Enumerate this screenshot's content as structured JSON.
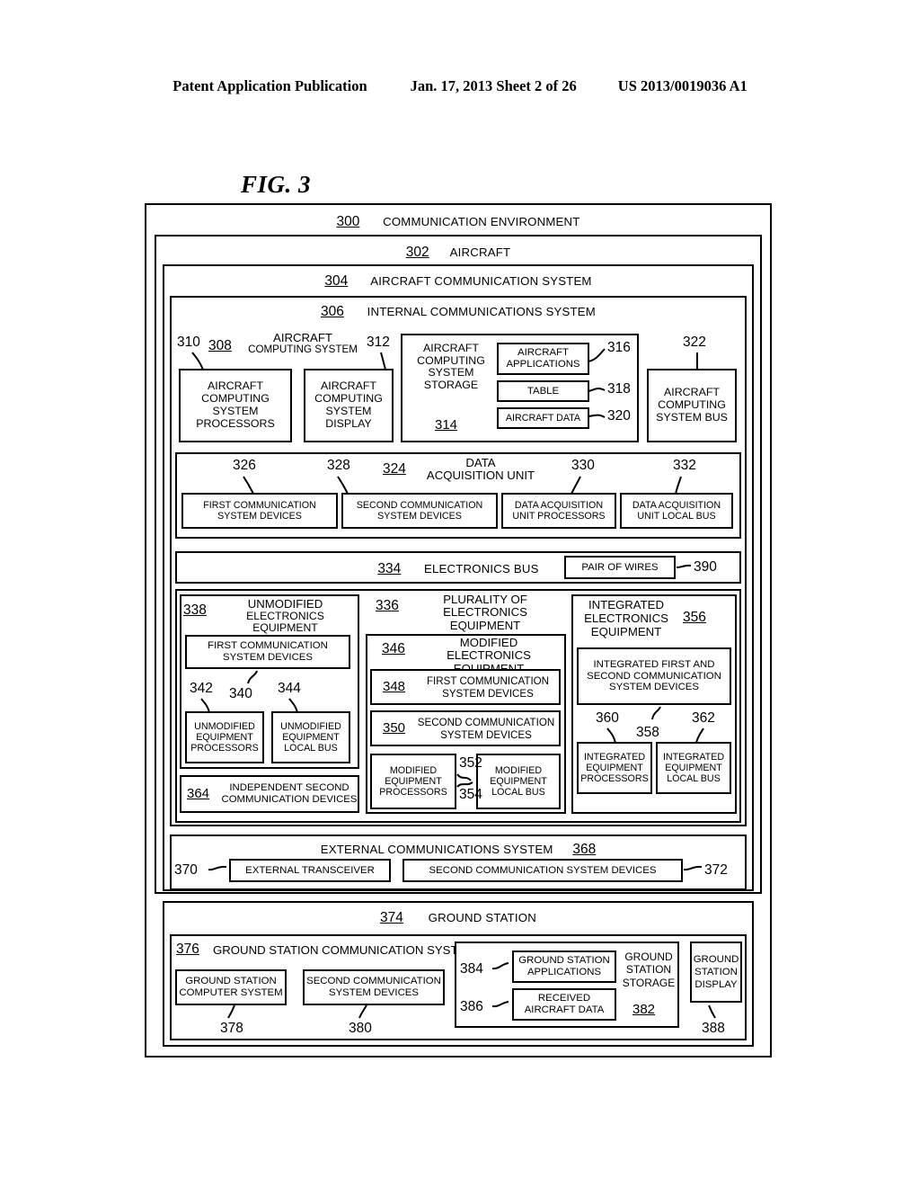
{
  "header": {
    "title": "Patent Application Publication",
    "date_sheet": "Jan. 17, 2013  Sheet 2 of 26",
    "pub_number": "US 2013/0019036 A1"
  },
  "figure": {
    "label": "FIG. 3"
  },
  "frames": {
    "communication_environment": {
      "num": "300",
      "label": "COMMUNICATION ENVIRONMENT"
    },
    "aircraft": {
      "num": "302",
      "label": "AIRCRAFT"
    },
    "aircraft_communication_system": {
      "num": "304",
      "label": "AIRCRAFT COMMUNICATION SYSTEM"
    },
    "internal_communications_system": {
      "num": "306",
      "label": "INTERNAL COMMUNICATIONS SYSTEM"
    }
  },
  "aircraft_computing_system": {
    "num": "308",
    "label_line1": "AIRCRAFT",
    "label_line2": "COMPUTING SYSTEM",
    "processors": {
      "num": "310",
      "label": "AIRCRAFT COMPUTING SYSTEM PROCESSORS"
    },
    "display": {
      "num": "312",
      "label": "AIRCRAFT COMPUTING SYSTEM DISPLAY"
    },
    "storage": {
      "num": "314",
      "label": "AIRCRAFT COMPUTING SYSTEM STORAGE",
      "items": [
        {
          "num": "316",
          "label": "AIRCRAFT APPLICATIONS"
        },
        {
          "num": "318",
          "label": "TABLE"
        },
        {
          "num": "320",
          "label": "AIRCRAFT DATA"
        }
      ]
    },
    "bus": {
      "num": "322",
      "label": "AIRCRAFT COMPUTING SYSTEM BUS"
    }
  },
  "data_acquisition_unit": {
    "num": "324",
    "label_line1": "DATA",
    "label_line2": "ACQUISITION UNIT",
    "items": [
      {
        "num": "326",
        "label": "FIRST COMMUNICATION SYSTEM DEVICES"
      },
      {
        "num": "328",
        "label": "SECOND COMMUNICATION SYSTEM DEVICES"
      },
      {
        "num": "330",
        "label": "DATA ACQUISITION UNIT PROCESSORS"
      },
      {
        "num": "332",
        "label": "DATA ACQUISITION UNIT LOCAL BUS"
      }
    ]
  },
  "electronics_bus": {
    "num": "334",
    "label": "ELECTRONICS BUS",
    "pair_of_wires": {
      "num": "390",
      "label": "PAIR OF WIRES"
    }
  },
  "plurality_of_electronics_equipment": {
    "num": "336",
    "label_line1": "PLURALITY OF",
    "label_line2": "ELECTRONICS EQUIPMENT",
    "unmodified": {
      "num": "338",
      "label_line1": "UNMODIFIED",
      "label_line2": "ELECTRONICS EQUIPMENT",
      "first_comm_devices": {
        "num": "340",
        "label": "FIRST COMMUNICATION SYSTEM DEVICES"
      },
      "processors": {
        "num": "342",
        "label": "UNMODIFIED EQUIPMENT PROCESSORS"
      },
      "local_bus": {
        "num": "344",
        "label": "UNMODIFIED EQUIPMENT LOCAL BUS"
      }
    },
    "independent_second_communication_devices": {
      "num": "364",
      "label": "INDEPENDENT SECOND COMMUNICATION DEVICES"
    },
    "modified": {
      "num": "346",
      "label_line1": "MODIFIED ELECTRONICS",
      "label_line2": "EQUIPMENT",
      "first_comm_devices": {
        "num": "348",
        "label_line1": "FIRST COMMUNICATION",
        "label_line2": "SYSTEM DEVICES"
      },
      "second_comm_devices": {
        "num": "350",
        "label_line1": "SECOND COMMUNICATION",
        "label_line2": "SYSTEM DEVICES"
      },
      "processors": {
        "num": "352",
        "label": "MODIFIED EQUIPMENT PROCESSORS"
      },
      "local_bus": {
        "num": "354",
        "label": "MODIFIED EQUIPMENT LOCAL BUS"
      }
    },
    "integrated": {
      "num": "356",
      "label_line1": "INTEGRATED",
      "label_line2": "ELECTRONICS",
      "label_line3": "EQUIPMENT",
      "combined_devices": {
        "num": "358",
        "label": "INTEGRATED FIRST AND SECOND COMMUNICATION SYSTEM DEVICES"
      },
      "processors": {
        "num": "360",
        "label": "INTEGRATED EQUIPMENT PROCESSORS"
      },
      "local_bus": {
        "num": "362",
        "label": "INTEGRATED EQUIPMENT LOCAL BUS"
      }
    }
  },
  "external_communications_system": {
    "num": "368",
    "label": "EXTERNAL COMMUNICATIONS SYSTEM",
    "transceiver": {
      "num": "370",
      "label": "EXTERNAL TRANSCEIVER"
    },
    "second_comm_devices": {
      "num": "372",
      "label": "SECOND COMMUNICATION SYSTEM DEVICES"
    }
  },
  "ground_station": {
    "num": "374",
    "label": "GROUND STATION",
    "communication_system": {
      "num": "376",
      "label": "GROUND STATION COMMUNICATION SYSTEM",
      "computer_system": {
        "num": "378",
        "label": "GROUND STATION COMPUTER SYSTEM"
      },
      "second_comm_devices": {
        "num": "380",
        "label": "SECOND COMMUNICATION SYSTEM DEVICES"
      }
    },
    "storage": {
      "num": "382",
      "label_line1": "GROUND",
      "label_line2": "STATION",
      "label_line3": "STORAGE",
      "items": [
        {
          "num": "384",
          "label": "GROUND STATION APPLICATIONS"
        },
        {
          "num": "386",
          "label": "RECEIVED AIRCRAFT DATA"
        }
      ]
    },
    "display": {
      "num": "388",
      "label_line1": "GROUND",
      "label_line2": "STATION",
      "label_line3": "DISPLAY"
    }
  }
}
